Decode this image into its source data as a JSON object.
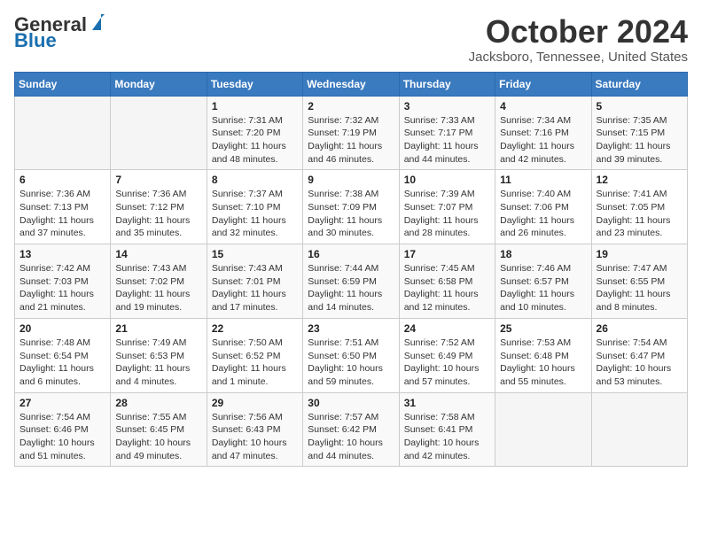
{
  "logo": {
    "general": "General",
    "blue": "Blue"
  },
  "title": "October 2024",
  "subtitle": "Jacksboro, Tennessee, United States",
  "days_of_week": [
    "Sunday",
    "Monday",
    "Tuesday",
    "Wednesday",
    "Thursday",
    "Friday",
    "Saturday"
  ],
  "weeks": [
    [
      {
        "day": "",
        "info": ""
      },
      {
        "day": "",
        "info": ""
      },
      {
        "day": "1",
        "info": "Sunrise: 7:31 AM\nSunset: 7:20 PM\nDaylight: 11 hours and 48 minutes."
      },
      {
        "day": "2",
        "info": "Sunrise: 7:32 AM\nSunset: 7:19 PM\nDaylight: 11 hours and 46 minutes."
      },
      {
        "day": "3",
        "info": "Sunrise: 7:33 AM\nSunset: 7:17 PM\nDaylight: 11 hours and 44 minutes."
      },
      {
        "day": "4",
        "info": "Sunrise: 7:34 AM\nSunset: 7:16 PM\nDaylight: 11 hours and 42 minutes."
      },
      {
        "day": "5",
        "info": "Sunrise: 7:35 AM\nSunset: 7:15 PM\nDaylight: 11 hours and 39 minutes."
      }
    ],
    [
      {
        "day": "6",
        "info": "Sunrise: 7:36 AM\nSunset: 7:13 PM\nDaylight: 11 hours and 37 minutes."
      },
      {
        "day": "7",
        "info": "Sunrise: 7:36 AM\nSunset: 7:12 PM\nDaylight: 11 hours and 35 minutes."
      },
      {
        "day": "8",
        "info": "Sunrise: 7:37 AM\nSunset: 7:10 PM\nDaylight: 11 hours and 32 minutes."
      },
      {
        "day": "9",
        "info": "Sunrise: 7:38 AM\nSunset: 7:09 PM\nDaylight: 11 hours and 30 minutes."
      },
      {
        "day": "10",
        "info": "Sunrise: 7:39 AM\nSunset: 7:07 PM\nDaylight: 11 hours and 28 minutes."
      },
      {
        "day": "11",
        "info": "Sunrise: 7:40 AM\nSunset: 7:06 PM\nDaylight: 11 hours and 26 minutes."
      },
      {
        "day": "12",
        "info": "Sunrise: 7:41 AM\nSunset: 7:05 PM\nDaylight: 11 hours and 23 minutes."
      }
    ],
    [
      {
        "day": "13",
        "info": "Sunrise: 7:42 AM\nSunset: 7:03 PM\nDaylight: 11 hours and 21 minutes."
      },
      {
        "day": "14",
        "info": "Sunrise: 7:43 AM\nSunset: 7:02 PM\nDaylight: 11 hours and 19 minutes."
      },
      {
        "day": "15",
        "info": "Sunrise: 7:43 AM\nSunset: 7:01 PM\nDaylight: 11 hours and 17 minutes."
      },
      {
        "day": "16",
        "info": "Sunrise: 7:44 AM\nSunset: 6:59 PM\nDaylight: 11 hours and 14 minutes."
      },
      {
        "day": "17",
        "info": "Sunrise: 7:45 AM\nSunset: 6:58 PM\nDaylight: 11 hours and 12 minutes."
      },
      {
        "day": "18",
        "info": "Sunrise: 7:46 AM\nSunset: 6:57 PM\nDaylight: 11 hours and 10 minutes."
      },
      {
        "day": "19",
        "info": "Sunrise: 7:47 AM\nSunset: 6:55 PM\nDaylight: 11 hours and 8 minutes."
      }
    ],
    [
      {
        "day": "20",
        "info": "Sunrise: 7:48 AM\nSunset: 6:54 PM\nDaylight: 11 hours and 6 minutes."
      },
      {
        "day": "21",
        "info": "Sunrise: 7:49 AM\nSunset: 6:53 PM\nDaylight: 11 hours and 4 minutes."
      },
      {
        "day": "22",
        "info": "Sunrise: 7:50 AM\nSunset: 6:52 PM\nDaylight: 11 hours and 1 minute."
      },
      {
        "day": "23",
        "info": "Sunrise: 7:51 AM\nSunset: 6:50 PM\nDaylight: 10 hours and 59 minutes."
      },
      {
        "day": "24",
        "info": "Sunrise: 7:52 AM\nSunset: 6:49 PM\nDaylight: 10 hours and 57 minutes."
      },
      {
        "day": "25",
        "info": "Sunrise: 7:53 AM\nSunset: 6:48 PM\nDaylight: 10 hours and 55 minutes."
      },
      {
        "day": "26",
        "info": "Sunrise: 7:54 AM\nSunset: 6:47 PM\nDaylight: 10 hours and 53 minutes."
      }
    ],
    [
      {
        "day": "27",
        "info": "Sunrise: 7:54 AM\nSunset: 6:46 PM\nDaylight: 10 hours and 51 minutes."
      },
      {
        "day": "28",
        "info": "Sunrise: 7:55 AM\nSunset: 6:45 PM\nDaylight: 10 hours and 49 minutes."
      },
      {
        "day": "29",
        "info": "Sunrise: 7:56 AM\nSunset: 6:43 PM\nDaylight: 10 hours and 47 minutes."
      },
      {
        "day": "30",
        "info": "Sunrise: 7:57 AM\nSunset: 6:42 PM\nDaylight: 10 hours and 44 minutes."
      },
      {
        "day": "31",
        "info": "Sunrise: 7:58 AM\nSunset: 6:41 PM\nDaylight: 10 hours and 42 minutes."
      },
      {
        "day": "",
        "info": ""
      },
      {
        "day": "",
        "info": ""
      }
    ]
  ]
}
